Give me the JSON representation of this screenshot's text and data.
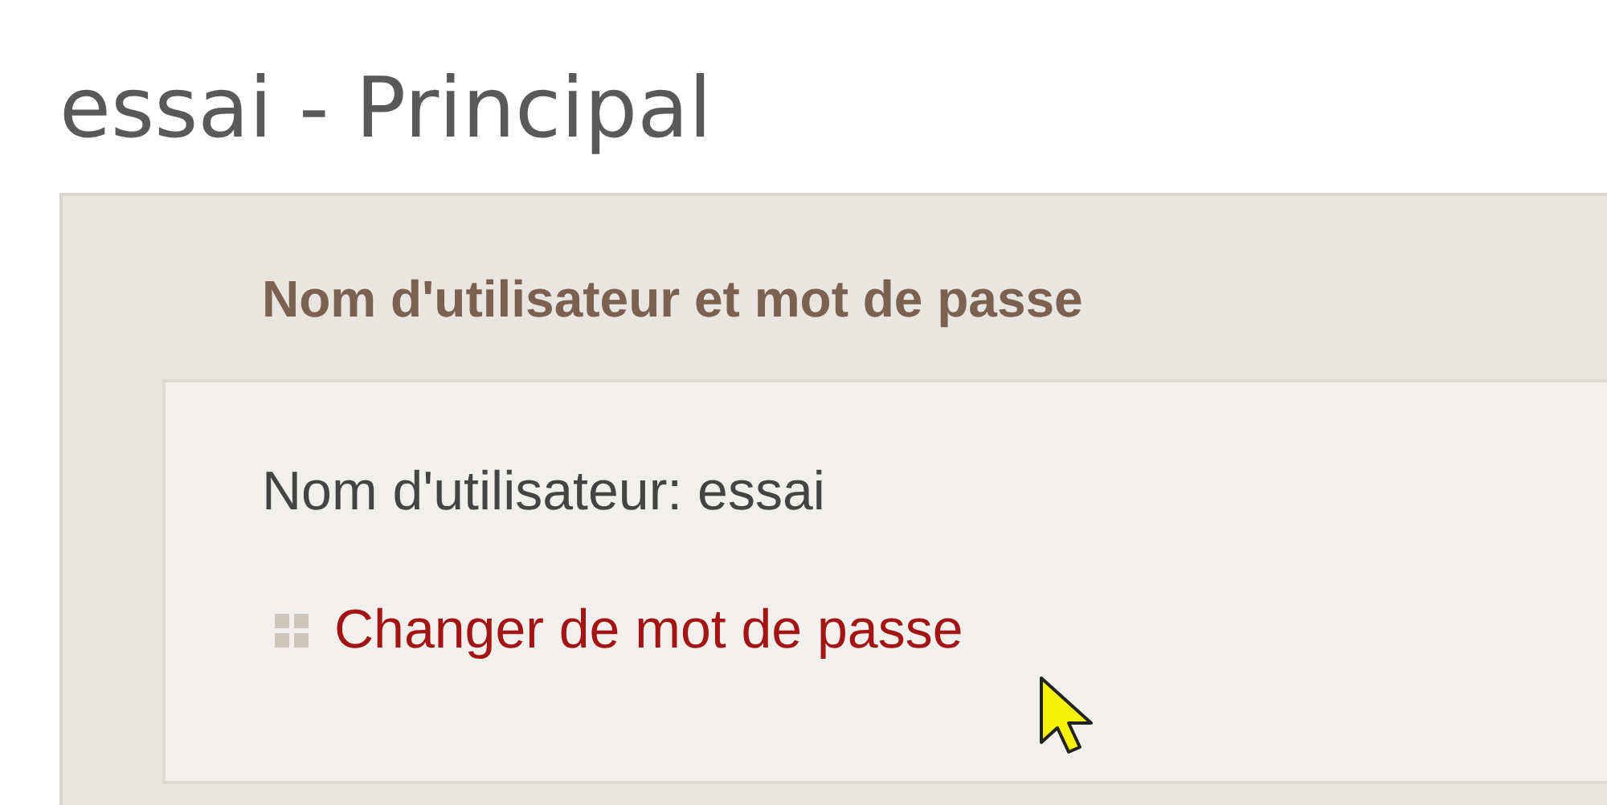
{
  "page_title": "essai - Principal",
  "section": {
    "heading": "Nom d'utilisateur et mot de passe",
    "username_line": "Nom d'utilisateur: essai",
    "links": [
      {
        "label": "Changer de mot de passe"
      }
    ]
  }
}
